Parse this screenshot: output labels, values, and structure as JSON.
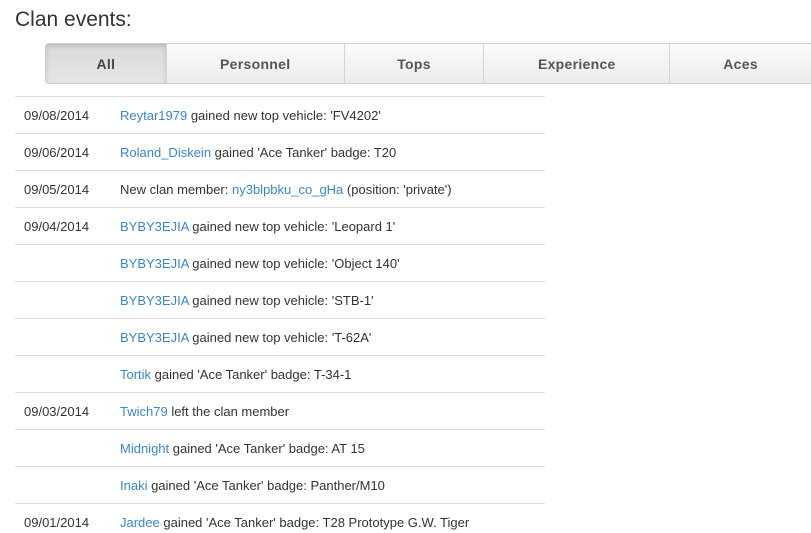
{
  "page": {
    "title": "Clan events:"
  },
  "tabs": [
    {
      "label": "All",
      "active": true
    },
    {
      "label": "Personnel",
      "active": false
    },
    {
      "label": "Tops",
      "active": false
    },
    {
      "label": "Experience",
      "active": false
    },
    {
      "label": "Aces",
      "active": false
    }
  ],
  "colors": {
    "link": "#3a87c8",
    "text": "#333333"
  },
  "events": [
    {
      "date": "09/08/2014",
      "pre": "",
      "player": "Reytar1979",
      "post": " gained new top vehicle: 'FV4202'"
    },
    {
      "date": "09/06/2014",
      "pre": "",
      "player": "Roland_Diskein",
      "post": " gained 'Ace Tanker' badge: T20"
    },
    {
      "date": "09/05/2014",
      "pre": "New clan member: ",
      "player": "ny3blpbku_co_gHa",
      "post": " (position: 'private')"
    },
    {
      "date": "09/04/2014",
      "pre": "",
      "player": "BYBY3EJIA",
      "post": " gained new top vehicle: 'Leopard 1'"
    },
    {
      "date": "",
      "pre": "",
      "player": "BYBY3EJIA",
      "post": " gained new top vehicle: 'Object 140'"
    },
    {
      "date": "",
      "pre": "",
      "player": "BYBY3EJIA",
      "post": " gained new top vehicle: 'STB-1'"
    },
    {
      "date": "",
      "pre": "",
      "player": "BYBY3EJIA",
      "post": " gained new top vehicle: 'T-62A'"
    },
    {
      "date": "",
      "pre": "",
      "player": "Tortik",
      "post": " gained 'Ace Tanker' badge: T-34-1"
    },
    {
      "date": "09/03/2014",
      "pre": "",
      "player": "Twich79",
      "post": " left the clan member"
    },
    {
      "date": "",
      "pre": "",
      "player": "Midnight",
      "post": " gained 'Ace Tanker' badge: AT 15"
    },
    {
      "date": "",
      "pre": "",
      "player": "Inaki",
      "post": " gained 'Ace Tanker' badge: Panther/M10"
    },
    {
      "date": "09/01/2014",
      "pre": "",
      "player": "Jardee",
      "post": " gained 'Ace Tanker' badge: T28 Prototype G.W. Tiger"
    }
  ]
}
